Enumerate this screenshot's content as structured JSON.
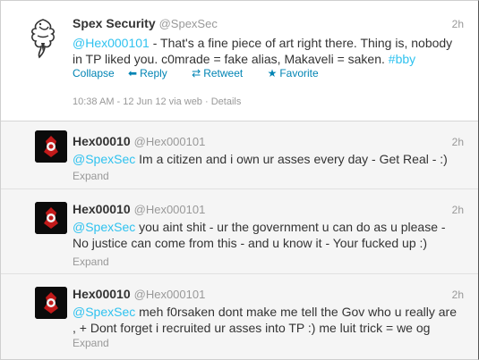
{
  "main_tweet": {
    "name": "Spex Security",
    "handle": "@SpexSec",
    "time": "2h",
    "mention": "@Hex000101",
    "text_line1": " - That's a fine piece of art right there. Thing is, nobody",
    "text_line2_a": "in TP liked you. c0mrade = fake alias, Makaveli = saken. ",
    "hashtag": "#bby",
    "actions": {
      "collapse": "Collapse",
      "reply": "Reply",
      "retweet": "Retweet",
      "favorite": "Favorite"
    },
    "meta_time": "10:38 AM - 12 Jun 12 via web",
    "meta_sep": " · ",
    "meta_details": "Details"
  },
  "replies": [
    {
      "name": "Hex00010",
      "handle": "@Hex000101",
      "time": "2h",
      "mention": "@SpexSec",
      "line1": " Im a citizen and i own ur asses every day - Get Real - :)",
      "line2": "",
      "expand": "Expand"
    },
    {
      "name": "Hex00010",
      "handle": "@Hex000101",
      "time": "2h",
      "mention": "@SpexSec",
      "line1": " you aint shit - ur the government u can do as u please -",
      "line2": "No justice can come from this - and u know it - Your fucked up :)",
      "expand": "Expand"
    },
    {
      "name": "Hex00010",
      "handle": "@Hex000101",
      "time": "2h",
      "mention": "@SpexSec",
      "line1": " meh f0rsaken dont make me tell the Gov who u really are",
      "line2": ", + Dont forget i recruited ur asses into TP :) me luit trick = we og",
      "expand": "Expand"
    }
  ],
  "colors": {
    "link": "#2fc2ef",
    "action": "#0084b4",
    "muted": "#999999"
  },
  "icons": {
    "avatar_main": "dragon-logo",
    "avatar_reply": "red-emblem-avatar",
    "reply": "reply-arrow-icon",
    "retweet": "retweet-icon",
    "favorite": "star-icon"
  }
}
